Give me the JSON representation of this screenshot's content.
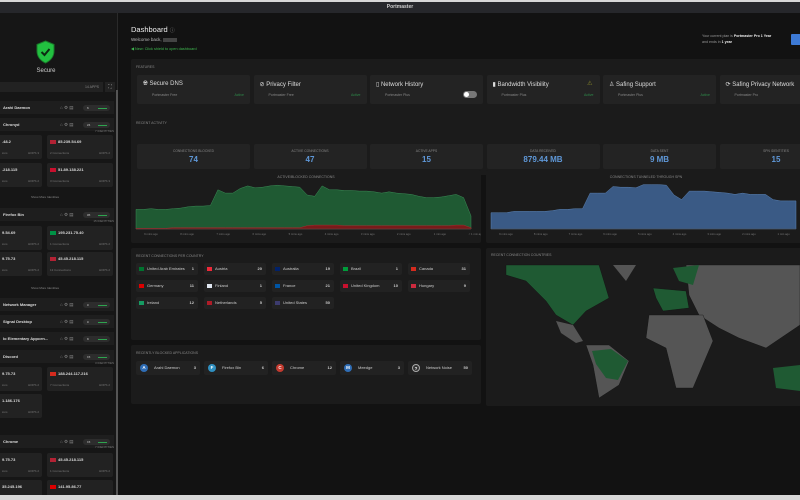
{
  "window": {
    "title": "Portmaster"
  },
  "sidebar": {
    "status": "Secure",
    "apps_count": "14 APPS",
    "show_more": "Show More Identities",
    "apps": [
      {
        "name": "Arahi Daemon",
        "badge": "6"
      },
      {
        "name": "Chronyd",
        "badge": "24",
        "identities": "7 IDENTITIES",
        "cards": [
          {
            "ip": ".48.2",
            "conn": "ions",
            "hops": "HOPS 3",
            "flag": ""
          },
          {
            "ip": "85.239.54.69",
            "conn": "2 Connections",
            "hops": "HOPS 2",
            "flag": "#b22234"
          },
          {
            "ip": ".218.115",
            "conn": "ions",
            "hops": "HOPS 2",
            "flag": ""
          },
          {
            "ip": "51.89.138.221",
            "conn": "3 Connections",
            "hops": "HOPS 3",
            "flag": "#c8102e"
          }
        ]
      },
      {
        "name": "Firefox Bin",
        "badge": "95",
        "identities": "15 IDENTITIES",
        "cards": [
          {
            "ip": "9.54.69",
            "conn": "ions",
            "hops": "HOPS 2",
            "flag": ""
          },
          {
            "ip": "195.231.75.40",
            "conn": "1 Connections",
            "hops": "HOPS 2",
            "flag": "#009246"
          },
          {
            "ip": "9.75.73",
            "conn": "ions",
            "hops": "HOPS 2",
            "flag": ""
          },
          {
            "ip": "45.45.218.115",
            "conn": "13 Connections",
            "hops": "HOPS 2",
            "flag": "#b22234"
          }
        ]
      },
      {
        "name": "Network Manager",
        "badge": "9"
      },
      {
        "name": "Signal Desktop",
        "badge": "9"
      },
      {
        "name": "Io Elementary Appcen...",
        "badge": "8"
      },
      {
        "name": "Discord",
        "badge": "15",
        "identities": "3 IDENTITIES",
        "cards": [
          {
            "ip": "9.75.73",
            "conn": "ions",
            "hops": "HOPS 2",
            "flag": ""
          },
          {
            "ip": "188.244.117.216",
            "conn": "7 Connections",
            "hops": "HOPS 2",
            "flag": "#d52b1e"
          },
          {
            "ip": "1.186.176",
            "conn": "ions",
            "hops": "HOPS 2",
            "flag": ""
          }
        ]
      },
      {
        "name": "Chrome",
        "badge": "15",
        "identities": "7 IDENTITIES",
        "cards": [
          {
            "ip": "9.75.73",
            "conn": "ions",
            "hops": "HOPS 2",
            "flag": ""
          },
          {
            "ip": "45.45.218.115",
            "conn": "1 Connections",
            "hops": "HOPS 2",
            "flag": "#b22234"
          },
          {
            "ip": "35.245.196",
            "conn": "",
            "hops": "",
            "flag": ""
          },
          {
            "ip": "141.95.86.77",
            "conn": "",
            "hops": "",
            "flag": "#dd0000"
          }
        ]
      }
    ]
  },
  "header": {
    "title": "Dashboard",
    "welcome": "Welcome back,",
    "hint": "New: Click shield to open dashboard",
    "plan_prefix": "Your current plan is",
    "plan_name": "Portmaster Pro 1 Year",
    "plan_ends_prefix": "and ends in",
    "plan_ends": "1 year"
  },
  "features": {
    "title": "FEATURES",
    "items": [
      {
        "name": "Secure DNS",
        "plan": "Portmaster Free",
        "status": "Active",
        "icon": "globe-icon"
      },
      {
        "name": "Privacy Filter",
        "plan": "Portmaster Free",
        "status": "Active",
        "icon": "eye-off-icon"
      },
      {
        "name": "Network History",
        "plan": "Portmaster Plus",
        "status": "",
        "icon": "book-icon"
      },
      {
        "name": "Bandwidth Visibility",
        "plan": "Portmaster Plus",
        "status": "Active",
        "icon": "bar-chart-icon"
      },
      {
        "name": "Safing Support",
        "plan": "Portmaster Plus",
        "status": "Active",
        "icon": "person-icon"
      },
      {
        "name": "Safing Privacy Network",
        "plan": "Portmaster Pro",
        "status": "",
        "icon": "network-icon"
      }
    ]
  },
  "activity": {
    "title": "RECENT ACTIVITY",
    "items": [
      {
        "label": "CONNECTIONS BLOCKED",
        "value": "74"
      },
      {
        "label": "ACTIVE CONNECTIONS",
        "value": "47"
      },
      {
        "label": "ACTIVE APPS",
        "value": "15"
      },
      {
        "label": "DATA RECEIVED",
        "value": "879.44 MB"
      },
      {
        "label": "DATA SENT",
        "value": "9 MB"
      },
      {
        "label": "SPN IDENTITIES",
        "value": "15"
      }
    ]
  },
  "chart_data": [
    {
      "type": "area",
      "title": "ACTIVE/BLOCKED CONNECTIONS",
      "x": [
        "9 mins ago",
        "8 mins ago",
        "7 mins ago",
        "6 mins ago",
        "5 mins ago",
        "4 mins ago",
        "3 mins ago",
        "2 mins ago",
        "1 min ago",
        "< 1 min ago"
      ],
      "series": [
        {
          "name": "active",
          "color": "#1f5a33",
          "values": [
            30,
            30,
            31,
            30,
            30,
            31,
            32,
            34,
            35,
            35,
            36,
            60,
            55,
            55,
            62,
            66,
            63,
            64,
            66,
            67,
            66,
            65,
            64,
            52,
            50,
            66,
            60,
            60,
            59,
            59,
            58,
            58,
            57,
            55,
            57,
            55,
            54,
            53,
            50,
            48,
            48,
            49,
            51,
            53,
            48,
            20
          ]
        },
        {
          "name": "blocked",
          "color": "#7a1a1a",
          "values": [
            1,
            1,
            1,
            1,
            1,
            2,
            2,
            2,
            2,
            2,
            2,
            2,
            2,
            2,
            2,
            2,
            2,
            2,
            2,
            2,
            2,
            2,
            2,
            5,
            6,
            6,
            6,
            6,
            5,
            5,
            5,
            5,
            5,
            5,
            5,
            5,
            5,
            5,
            5,
            5,
            5,
            5,
            5,
            6,
            6,
            2
          ]
        }
      ],
      "ylim": [
        0,
        75
      ]
    },
    {
      "type": "area",
      "title": "CONNECTIONS TUNNELED THROUGH SPN",
      "x": [
        "9 mins ago",
        "8 mins ago",
        "7 mins ago",
        "6 mins ago",
        "5 mins ago",
        "4 mins ago",
        "3 mins ago",
        "2 mins ago",
        "1 min ago"
      ],
      "series": [
        {
          "name": "tunneled",
          "color": "#3a5a85",
          "values": [
            25,
            25,
            25,
            27,
            27,
            27,
            27,
            27,
            28,
            30,
            30,
            31,
            31,
            55,
            55,
            55,
            65,
            64,
            64,
            63,
            68,
            68,
            68,
            67,
            52,
            45,
            58,
            58,
            58,
            57,
            56,
            55,
            53,
            55,
            53,
            53,
            53,
            45,
            43,
            43,
            43
          ]
        }
      ],
      "ylim": [
        0,
        75
      ]
    }
  ],
  "countries": {
    "title": "RECENT CONNECTIONS PER COUNTRY",
    "items": [
      {
        "name": "United Arab Emirates",
        "count": "1",
        "flag": "#00732f"
      },
      {
        "name": "Austria",
        "count": "20",
        "flag": "#ed2939"
      },
      {
        "name": "Australia",
        "count": "19",
        "flag": "#012169"
      },
      {
        "name": "Brazil",
        "count": "1",
        "flag": "#009c3b"
      },
      {
        "name": "Canada",
        "count": "31",
        "flag": "#d52b1e"
      },
      {
        "name": "Germany",
        "count": "11",
        "flag": "#dd0000"
      },
      {
        "name": "Finland",
        "count": "1",
        "flag": "#dfe6f0"
      },
      {
        "name": "France",
        "count": "21",
        "flag": "#0055a4"
      },
      {
        "name": "United Kingdom",
        "count": "10",
        "flag": "#c8102e"
      },
      {
        "name": "Hungary",
        "count": "9",
        "flag": "#cd2a3e"
      },
      {
        "name": "Ireland",
        "count": "12",
        "flag": "#169b62"
      },
      {
        "name": "Netherlands",
        "count": "5",
        "flag": "#ae1c28"
      },
      {
        "name": "United States",
        "count": "50",
        "flag": "#3c3b6e"
      }
    ]
  },
  "blocked": {
    "title": "RECENTLY BLOCKED APPLICATIONS",
    "items": [
      {
        "letter": "A",
        "name": "Arahi Daemon",
        "count": "3",
        "color": "#2f6db5"
      },
      {
        "letter": "F",
        "name": "Firefox Bin",
        "count": "6",
        "color": "#2f8fc0"
      },
      {
        "letter": "C",
        "name": "Chrome",
        "count": "12",
        "color": "#c23a2f"
      },
      {
        "letter": "M",
        "name": "Meedge",
        "count": "3",
        "color": "#2f6db5"
      },
      {
        "letter": "?",
        "name": "Network Noise",
        "count": "50",
        "color": "#333333"
      }
    ]
  },
  "map": {
    "title": "RECENT CONNECTION COUNTRIES",
    "active_color": "#1f5a33",
    "inactive_color": "#555555"
  }
}
